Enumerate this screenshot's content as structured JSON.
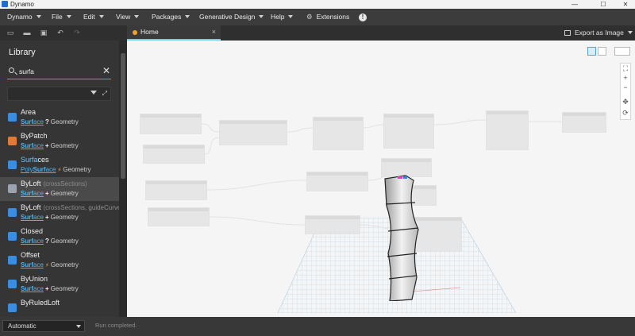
{
  "window": {
    "title": "Dynamo",
    "minimize": "—",
    "maximize": "☐",
    "close": "✕"
  },
  "menu": [
    {
      "label": "Dynamo",
      "caret": true
    },
    {
      "label": "File",
      "caret": true
    },
    {
      "label": "Edit",
      "caret": true
    },
    {
      "label": "View",
      "caret": true
    },
    {
      "label": "Packages",
      "caret": true
    },
    {
      "label": "Generative Design",
      "caret": true
    },
    {
      "label": "Help",
      "caret": true
    },
    {
      "label": "Extensions",
      "caret": false,
      "icon": "puzzle-icon"
    }
  ],
  "toolbar": {
    "icons": [
      "new-file-icon",
      "open-folder-icon",
      "save-icon",
      "undo-icon",
      "redo-icon"
    ],
    "export_label": "Export as Image"
  },
  "tab": {
    "label": "Home",
    "close": "×"
  },
  "library": {
    "title": "Library",
    "search": {
      "value": "surfa",
      "clear": "✕"
    },
    "results": [
      {
        "name": "Area",
        "name_hl": "",
        "params": "",
        "category_hl": "Surf",
        "category_rest": "ace",
        "type_glyph": "?",
        "type": "query",
        "group": "Geometry",
        "icon_color": "#3a8de0"
      },
      {
        "name": "ByPatch",
        "name_hl": "",
        "params": "",
        "category_hl": "Surf",
        "category_rest": "ace",
        "type_glyph": "+",
        "type": "create",
        "group": "Geometry",
        "icon_color": "#e07a3a"
      },
      {
        "name": "ces",
        "name_hl": "Surfa",
        "params": "",
        "category_pre": "Poly",
        "category_hl": "Surf",
        "category_rest": "ace",
        "type_glyph": "⚡",
        "type": "action",
        "group": "Geometry",
        "icon_color": "#3a8de0"
      },
      {
        "name": "ByLoft",
        "name_hl": "",
        "params": "(crossSections)",
        "category_hl": "Surf",
        "category_rest": "ace",
        "type_glyph": "+",
        "type": "create",
        "group": "Geometry",
        "icon_color": "#9aa4b0",
        "selected": true
      },
      {
        "name": "ByLoft",
        "name_hl": "",
        "params": "(crossSections, guideCurves)",
        "category_hl": "Surf",
        "category_rest": "ace",
        "type_glyph": "+",
        "type": "create",
        "group": "Geometry",
        "icon_color": "#3a8de0"
      },
      {
        "name": "Closed",
        "name_hl": "",
        "params": "",
        "category_hl": "Surf",
        "category_rest": "ace",
        "type_glyph": "?",
        "type": "query",
        "group": "Geometry",
        "icon_color": "#3a8de0"
      },
      {
        "name": "Offset",
        "name_hl": "",
        "params": "",
        "category_hl": "Surf",
        "category_rest": "ace",
        "type_glyph": "⚡",
        "type": "action",
        "group": "Geometry",
        "icon_color": "#3a8de0"
      },
      {
        "name": "ByUnion",
        "name_hl": "",
        "params": "",
        "category_hl": "Surf",
        "category_rest": "ace",
        "type_glyph": "+",
        "type": "create",
        "group": "Geometry",
        "icon_color": "#3a8de0"
      },
      {
        "name": "ByRuledLoft",
        "name_hl": "",
        "params": "",
        "category_hl": "",
        "category_rest": "",
        "type_glyph": "",
        "type": "create",
        "group": "",
        "icon_color": "#3a8de0"
      }
    ]
  },
  "status": {
    "run_mode": "Automatic",
    "message": "Run completed."
  },
  "colors": {
    "accent": "#4aa7d9",
    "highlight": "#6cc7ff",
    "tab_dot": "#f0a12c"
  }
}
